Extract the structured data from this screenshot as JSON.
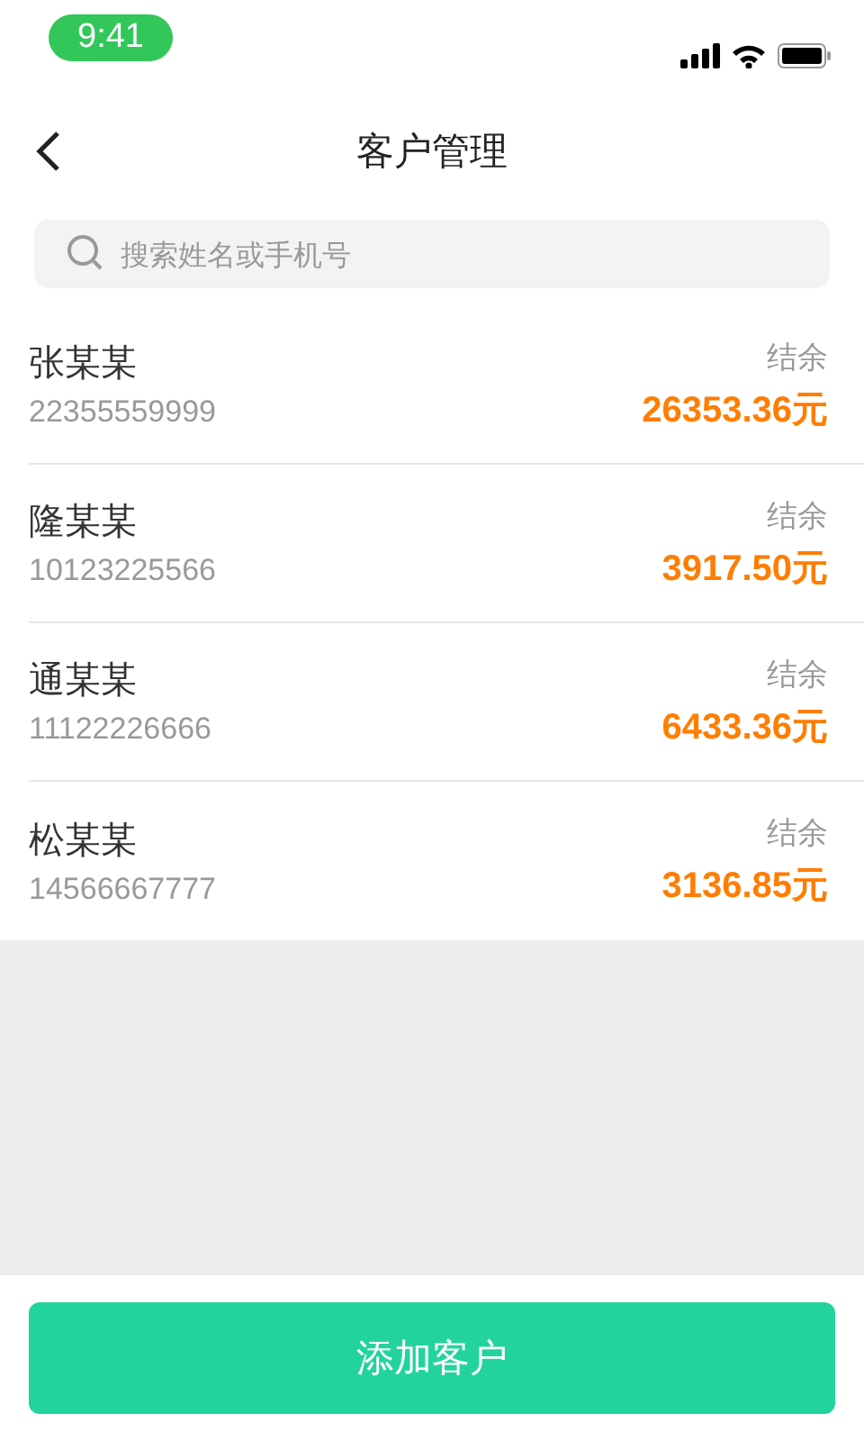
{
  "status_bar": {
    "time": "9:41"
  },
  "nav": {
    "title": "客户管理"
  },
  "search": {
    "placeholder": "搜索姓名或手机号"
  },
  "customers": [
    {
      "name": "张某某",
      "phone": "22355559999",
      "balance_label": "结余",
      "balance": "26353.36元"
    },
    {
      "name": "隆某某",
      "phone": "10123225566",
      "balance_label": "结余",
      "balance": "3917.50元"
    },
    {
      "name": "通某某",
      "phone": "11122226666",
      "balance_label": "结余",
      "balance": "6433.36元"
    },
    {
      "name": "松某某",
      "phone": "14566667777",
      "balance_label": "结余",
      "balance": "3136.85元"
    }
  ],
  "add_button": {
    "label": "添加客户"
  }
}
